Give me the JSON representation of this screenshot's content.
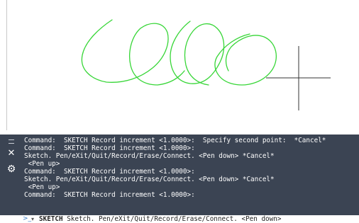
{
  "command_window": {
    "history": [
      "Command:  SKETCH Record increment <1.0000>:  Specify second point:  *Cancel*",
      "Command:  SKETCH Record increment <1.0000>:",
      "Sketch. Pen/eXit/Quit/Record/Erase/Connect. <Pen down> *Cancel*",
      " <Pen up>",
      "Command:  SKETCH Record increment <1.0000>:",
      "Sketch. Pen/eXit/Quit/Record/Erase/Connect. <Pen down> *Cancel*",
      " <Pen up>",
      "Command:  SKETCH Record increment <1.0000>:"
    ],
    "prompt": {
      "command": "SKETCH",
      "text": " Sketch. Pen/eXit/Quit/Record/Erase/Connect. <Pen down>"
    },
    "icons": {
      "grip": "grip-icon",
      "close": "close-icon",
      "settings": "wrench-icon",
      "prompt": "command-prompt-icon",
      "dropdown": "dropdown-arrow-icon"
    }
  },
  "drawing": {
    "stroke_color": "#37d637",
    "crosshair_color": "#333333"
  }
}
